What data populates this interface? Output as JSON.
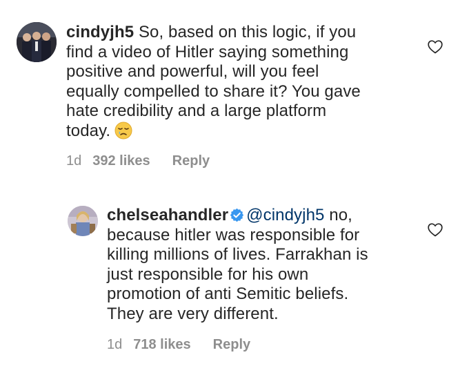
{
  "comments": [
    {
      "username": "cindyjh5",
      "text_lines": [
        " So, based on this logic, if you",
        "find a video of Hitler saying something",
        "positive and powerful, will you feel",
        "equally compelled to share it? You gave",
        "hate credibility and a large platform",
        "today."
      ],
      "emoji": "sad-relieved-face-icon",
      "time": "1d",
      "likes": "392 likes",
      "reply_label": "Reply",
      "like_icon": "heart-outline-icon"
    },
    {
      "username": "chelseahandler",
      "verified": true,
      "mention": "@cindyjh5",
      "text_lines": [
        " no,",
        "because hitler was responsible for",
        "killing millions of lives. Farrakhan is",
        "just responsible for his own",
        "promotion of anti Semitic beliefs.",
        "They are very different."
      ],
      "time": "1d",
      "likes": "718 likes",
      "reply_label": "Reply",
      "like_icon": "heart-outline-icon"
    }
  ],
  "colors": {
    "text": "#262626",
    "meta": "#8e8e8e",
    "mention": "#003569",
    "verified": "#3897f0"
  }
}
